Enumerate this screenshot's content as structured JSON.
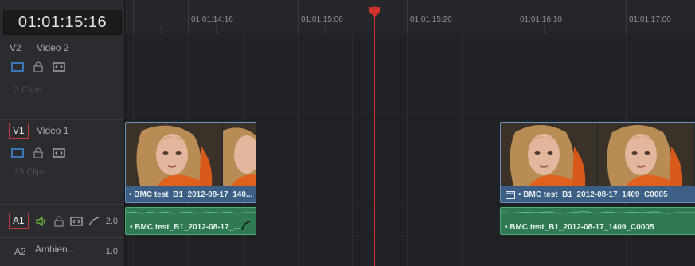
{
  "timecode": "01:01:15:16",
  "ruler": {
    "labels": [
      "01:01:14:16",
      "01:01:15:06",
      "01:01:15:20",
      "01:01:16:10",
      "01:01:17:00"
    ]
  },
  "tracks": {
    "v2": {
      "id": "V2",
      "name": "Video 2",
      "clip_count": "3 Clips"
    },
    "v1": {
      "id": "V1",
      "name": "Video 1",
      "clip_count": "23 Clips"
    },
    "a1": {
      "id": "A1",
      "level": "2.0"
    },
    "a2": {
      "id": "A2",
      "name": "Ambien...",
      "level": "1.0"
    }
  },
  "clips": {
    "video_left": "• BMC test_B1_2012-08-17_140...",
    "video_right": "• BMC test_B1_2012-08-17_1409_C0005",
    "audio_left": "• BMC test_B1_2012-08-17_...",
    "audio_right": "• BMC test_B1_2012-08-17_1409_C0005"
  },
  "colors": {
    "playhead": "#c8322f",
    "video_clip": "#3d5f86",
    "audio_clip": "#2f7a52",
    "selected_track_outline": "#c23b3b",
    "audio_enabled": "#6fbf3a"
  },
  "icons": [
    "monitor-icon",
    "lock-icon",
    "auto-select-icon",
    "speaker-icon",
    "fade-curve-icon",
    "film-strip-icon"
  ]
}
